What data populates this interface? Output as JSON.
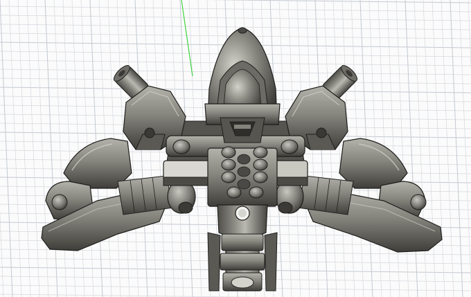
{
  "viewport": {
    "background": "#fbfbfb",
    "grid_color": "#d4d8de",
    "grid_major_color": "#c3c8cf",
    "y_axis_color": "#3fd23f"
  },
  "model": {
    "colors": {
      "body": "#777670",
      "body_light": "#a8a79f",
      "body_highlight": "#cfcec8",
      "body_dark": "#4a4945",
      "body_shadow": "#2e2d2a",
      "edge": "#1e1e1c"
    }
  }
}
